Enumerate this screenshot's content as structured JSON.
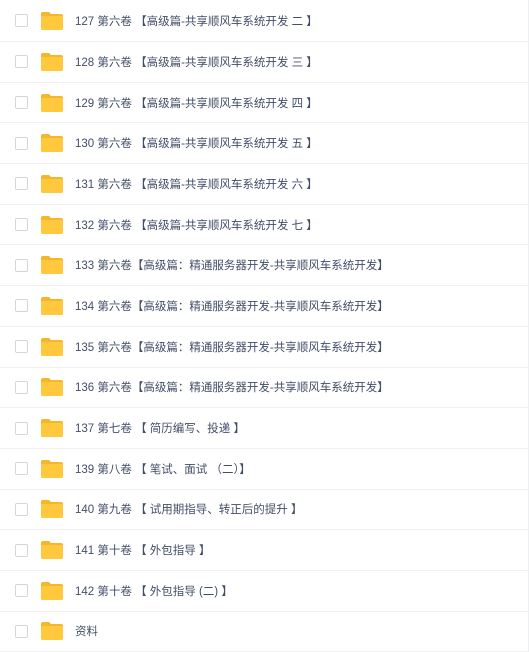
{
  "files": [
    {
      "name": "127 第六卷 【高级篇-共享顺风车系统开发 二 】"
    },
    {
      "name": "128 第六卷 【高级篇-共享顺风车系统开发 三 】"
    },
    {
      "name": "129 第六卷 【高级篇-共享顺风车系统开发 四 】"
    },
    {
      "name": "130 第六卷 【高级篇-共享顺风车系统开发 五 】"
    },
    {
      "name": "131 第六卷 【高级篇-共享顺风车系统开发 六 】"
    },
    {
      "name": "132 第六卷 【高级篇-共享顺风车系统开发 七 】"
    },
    {
      "name": "133 第六卷【高级篇：精通服务器开发-共享顺风车系统开发】"
    },
    {
      "name": "134 第六卷【高级篇：精通服务器开发-共享顺风车系统开发】"
    },
    {
      "name": "135 第六卷【高级篇：精通服务器开发-共享顺风车系统开发】"
    },
    {
      "name": "136 第六卷【高级篇：精通服务器开发-共享顺风车系统开发】"
    },
    {
      "name": "137 第七卷 【 简历编写、投递 】"
    },
    {
      "name": "139 第八卷 【 笔试、面试 （二）】"
    },
    {
      "name": "140 第九卷 【 试用期指导、转正后的提升 】"
    },
    {
      "name": "141 第十卷 【 外包指导 】"
    },
    {
      "name": "142 第十卷 【 外包指导 (二) 】"
    },
    {
      "name": "资料"
    }
  ],
  "icons": {
    "folder": "folder-icon",
    "folder_color": "#ffc83d",
    "folder_back_color": "#f5b72a"
  }
}
